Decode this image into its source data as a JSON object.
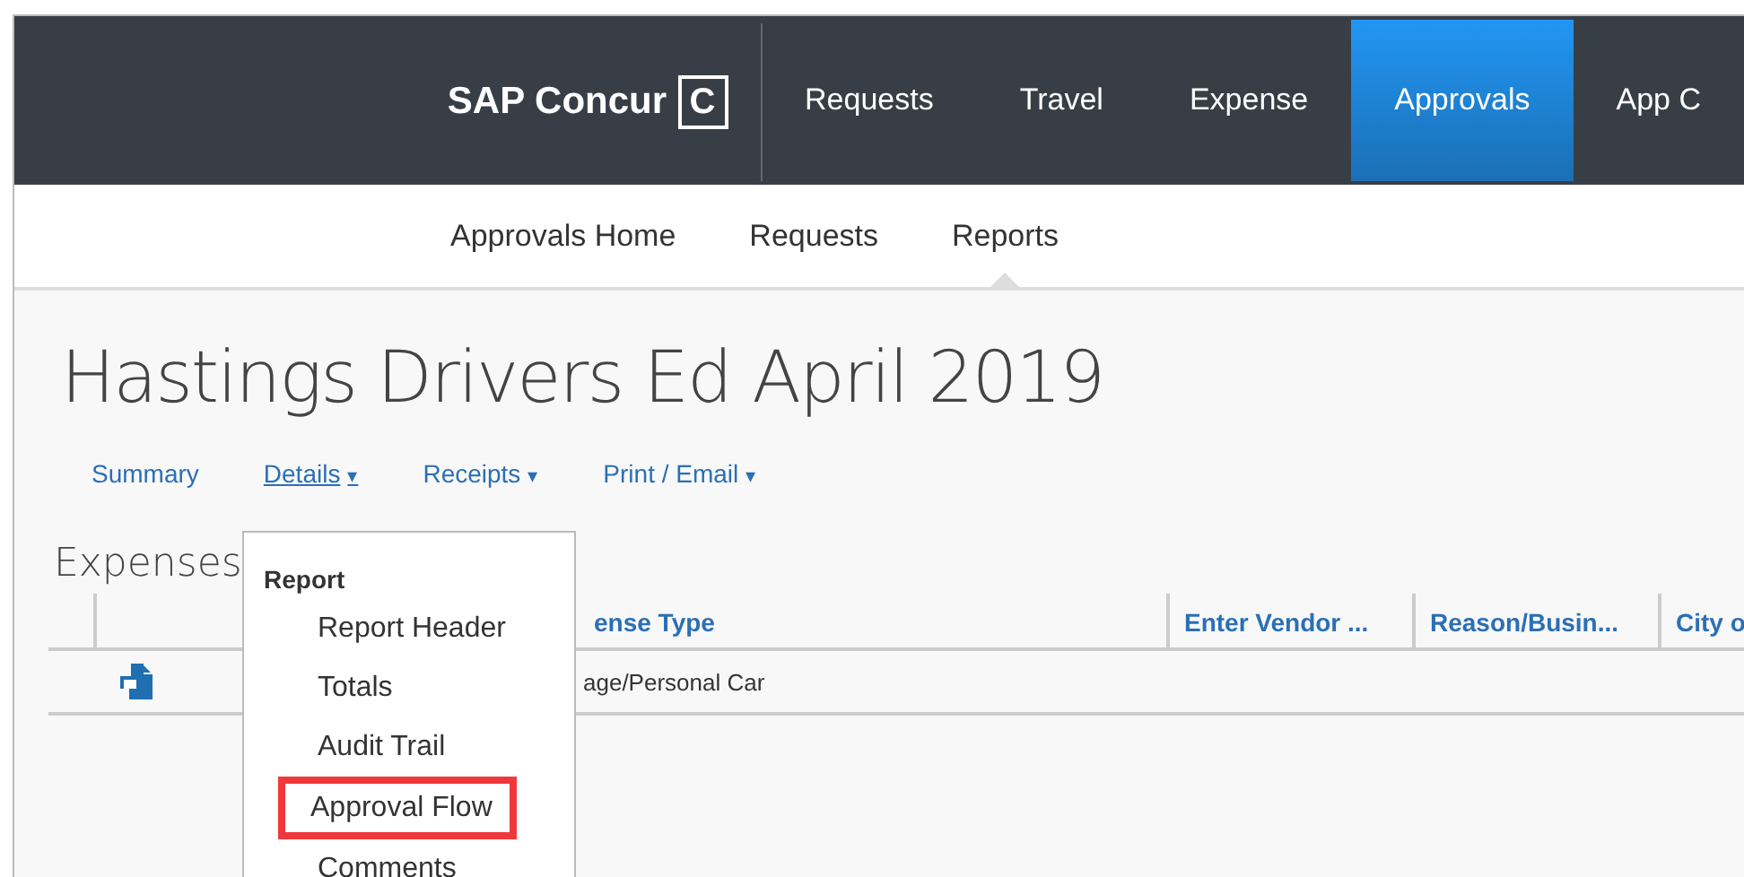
{
  "brand": {
    "name": "SAP Concur",
    "mark": "C"
  },
  "nav": [
    {
      "label": "Requests",
      "selected": false
    },
    {
      "label": "Travel",
      "selected": false
    },
    {
      "label": "Expense",
      "selected": false
    },
    {
      "label": "Approvals",
      "selected": true
    },
    {
      "label": "App C",
      "selected": false
    }
  ],
  "subnav": [
    {
      "label": "Approvals Home",
      "selected": false
    },
    {
      "label": "Requests",
      "selected": false
    },
    {
      "label": "Reports",
      "selected": true
    }
  ],
  "title": "Hastings Drivers Ed April 2019",
  "tabs": [
    {
      "label": "Summary",
      "open": false
    },
    {
      "label": "Details",
      "caret": "▾",
      "open": true
    },
    {
      "label": "Receipts",
      "caret": "▾",
      "open": false
    },
    {
      "label": "Print / Email",
      "caret": "▾",
      "open": false
    }
  ],
  "section_title": "Expenses",
  "table": {
    "columns": [
      "ense Type",
      "Enter Vendor ...",
      "Reason/Busin...",
      "City o"
    ],
    "rows": [
      {
        "cells": [
          "age/Personal Car",
          "",
          "",
          ""
        ]
      }
    ]
  },
  "menu": {
    "heading": "Report",
    "items": [
      {
        "label": "Report Header",
        "highlighted": false
      },
      {
        "label": "Totals",
        "highlighted": false
      },
      {
        "label": "Audit Trail",
        "highlighted": false
      },
      {
        "label": "Approval Flow",
        "highlighted": true
      },
      {
        "label": "Comments",
        "highlighted": false
      }
    ]
  }
}
